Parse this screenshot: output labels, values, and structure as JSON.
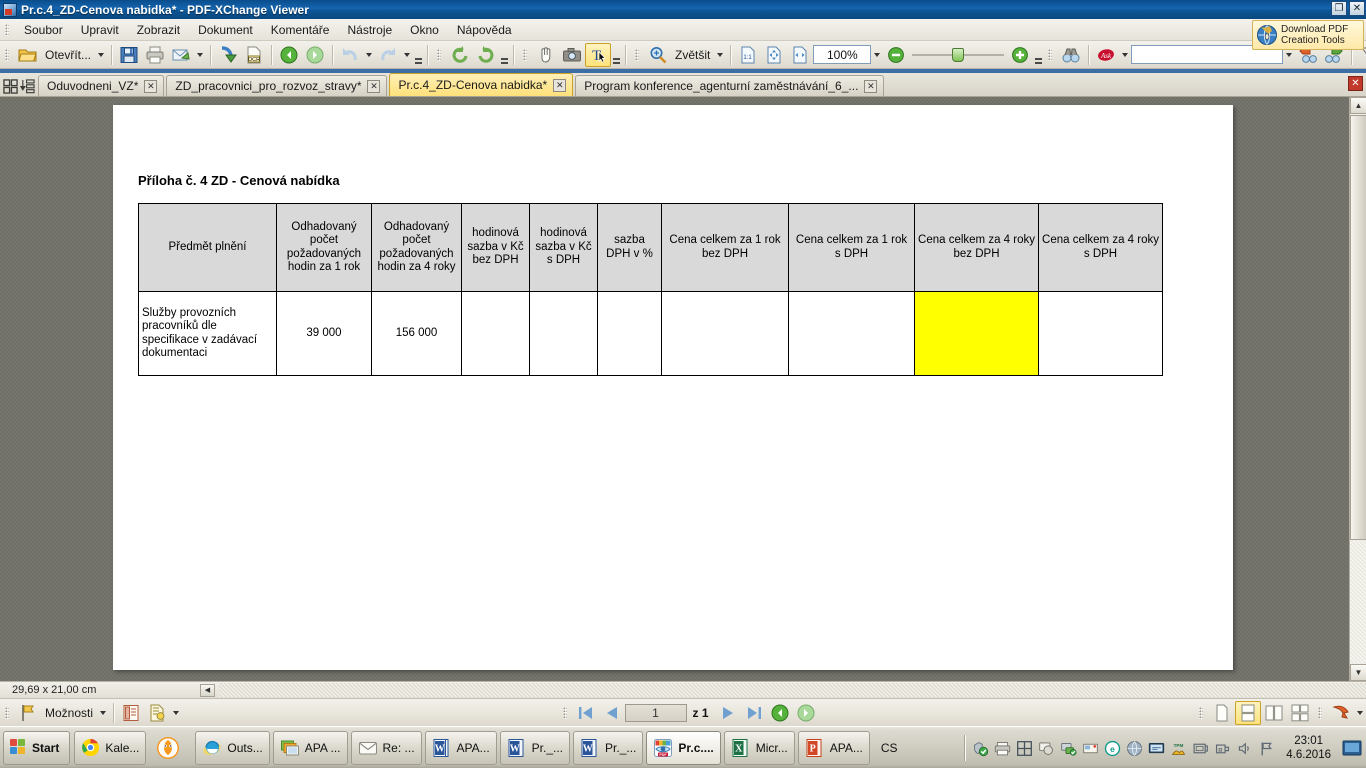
{
  "window": {
    "title": "Pr.c.4_ZD-Cenova nabidka* - PDF-XChange Viewer",
    "restore_label": "❐",
    "close_label": "✕"
  },
  "menu": {
    "items": [
      {
        "label": "Soubor"
      },
      {
        "label": "Upravit"
      },
      {
        "label": "Zobrazit"
      },
      {
        "label": "Dokument"
      },
      {
        "label": "Komentáře"
      },
      {
        "label": "Nástroje"
      },
      {
        "label": "Okno"
      },
      {
        "label": "Nápověda"
      }
    ]
  },
  "toolbar": {
    "open_label": "Otevřít...",
    "zoom_tool_label": "Zvětšit",
    "zoom_value": "100%",
    "search_value": "",
    "search_placeholder": "",
    "ask_label": "Ask"
  },
  "promo": {
    "line1": "Download PDF",
    "line2": "Creation Tools"
  },
  "tabs": {
    "close_glyph": "✕",
    "items": [
      {
        "label": "Oduvodneni_VZ*",
        "active": false
      },
      {
        "label": "ZD_pracovnici_pro_rozvoz_stravy*",
        "active": false
      },
      {
        "label": "Pr.c.4_ZD-Cenova nabidka*",
        "active": true
      },
      {
        "label": "Program konference_agenturní zaměstnávání_6_...",
        "active": false
      }
    ]
  },
  "document": {
    "heading": "Příloha č. 4 ZD - Cenová nabídka",
    "table": {
      "headers": [
        "Předmět plnění",
        "Odhadovaný počet požadovaných hodin za 1 rok",
        "Odhadovaný počet požadovaných hodin za 4 roky",
        "hodinová sazba v Kč bez DPH",
        "hodinová sazba v Kč s DPH",
        "sazba DPH v %",
        "Cena celkem za 1 rok bez DPH",
        "Cena celkem za 1 rok s DPH",
        "Cena celkem za 4 roky bez DPH",
        "Cena celkem za 4 roky s DPH"
      ],
      "rows": [
        {
          "cells": [
            "Služby provozních pracovníků dle specifikace v zadávací dokumentaci",
            "39 000",
            "156 000",
            "",
            "",
            "",
            "",
            "",
            "",
            ""
          ],
          "highlight_index": 8
        }
      ],
      "highlight_color": "#ffff00",
      "header_bg": "#d9d9d9"
    }
  },
  "status": {
    "page_size": "29,69 x 21,00 cm"
  },
  "bottombar": {
    "options_label": "Možnosti",
    "page_current": "1",
    "page_of": "z 1"
  },
  "taskbar": {
    "start_label": "Start",
    "items": [
      {
        "label": "Kale...",
        "icon": "chrome-icon",
        "active": false
      },
      {
        "label": "",
        "icon": "gimp-icon",
        "active": false
      },
      {
        "label": "Outs...",
        "icon": "internet-explorer-icon",
        "active": false
      },
      {
        "label": "APA ...",
        "icon": "photo-gallery-icon",
        "active": false
      },
      {
        "label": "Re: ...",
        "icon": "mail-icon",
        "active": false
      },
      {
        "label": "APA...",
        "icon": "word-icon",
        "active": false
      },
      {
        "label": "Pr._...",
        "icon": "word-icon",
        "active": false
      },
      {
        "label": "Pr._...",
        "icon": "word-icon",
        "active": false
      },
      {
        "label": "Pr.c....",
        "icon": "pdf-xchange-icon",
        "active": true
      },
      {
        "label": "Micr...",
        "icon": "excel-icon",
        "active": false
      },
      {
        "label": "APA...",
        "icon": "powerpoint-icon",
        "active": false
      }
    ],
    "language": "CS",
    "clock_time": "23:01",
    "clock_date": "4.6.2016"
  }
}
